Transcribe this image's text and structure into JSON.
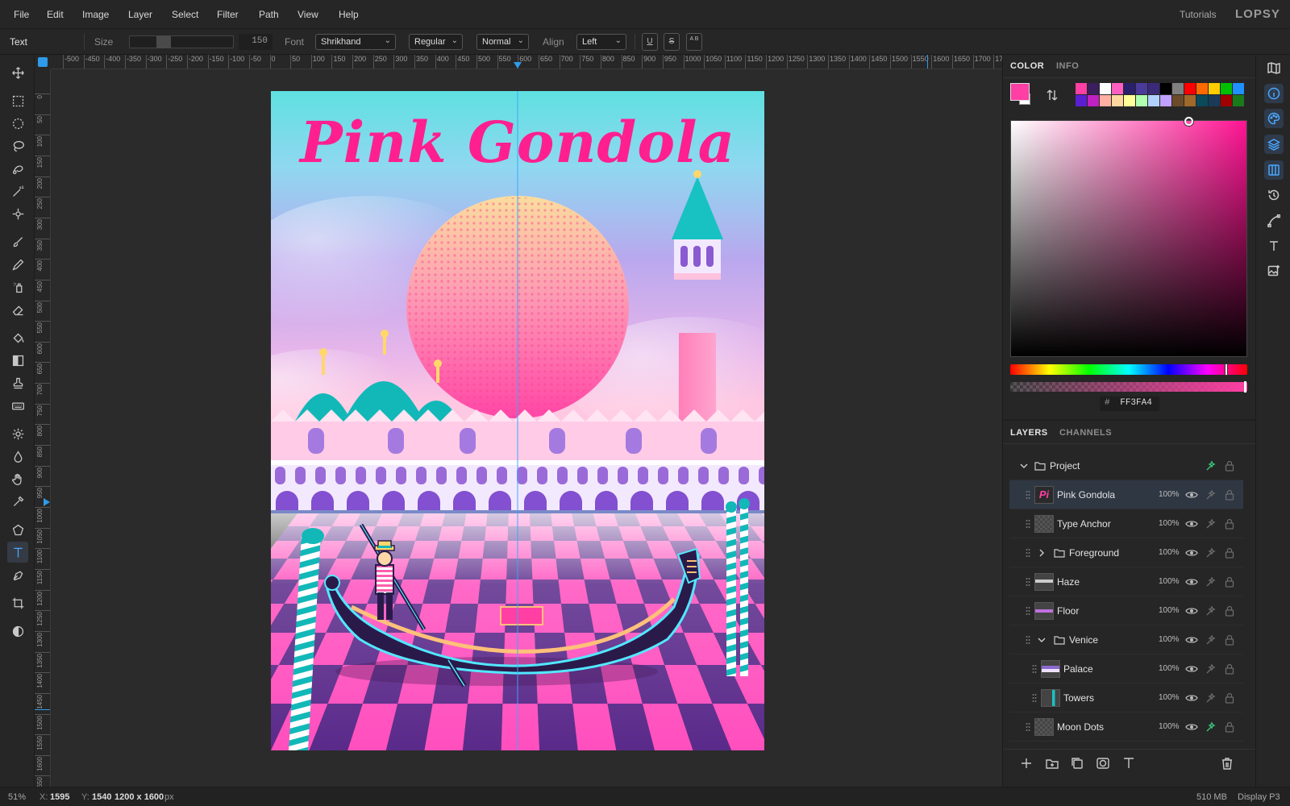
{
  "menu": [
    "File",
    "Edit",
    "Image",
    "Layer",
    "Select",
    "Filter",
    "Path",
    "View",
    "Help"
  ],
  "brand": {
    "tutorials": "Tutorials",
    "logo": "LOPSY"
  },
  "options": {
    "tool_label": "Text",
    "size_label": "Size",
    "size_value": "150",
    "font_label": "Font",
    "font_value": "Shrikhand",
    "style_value": "Regular",
    "blend_value": "Normal",
    "align_label": "Align",
    "align_value": "Left",
    "underline": "U",
    "strike": "S",
    "case": "A B"
  },
  "tools": [
    "move-icon",
    "rect-select-icon",
    "ellipse-select-icon",
    "lasso-icon",
    "quick-select-icon",
    "magic-wand-icon",
    "spot-heal-icon",
    "brush-icon",
    "pencil-icon",
    "clone-spray-icon",
    "eraser-icon",
    "fill-icon",
    "gradient-icon",
    "stamp-icon",
    "smudge-icon",
    "dodge-icon",
    "blur-icon",
    "hand-icon",
    "eyedropper-icon",
    "shape-icon",
    "text-icon",
    "pen-icon",
    "crop-icon",
    "contrast-icon"
  ],
  "active_tool": "text-icon",
  "ruler": {
    "top": [
      "-500",
      "-450",
      "-400",
      "-350",
      "-300",
      "-250",
      "-200",
      "-150",
      "-100",
      "-50",
      "0",
      "50",
      "100",
      "150",
      "200",
      "250",
      "300",
      "350",
      "400",
      "450",
      "500",
      "550",
      "600",
      "650",
      "700",
      "750",
      "800",
      "850",
      "900",
      "950",
      "1000",
      "1050",
      "1100",
      "1150",
      "1200",
      "1250",
      "1300",
      "1350",
      "1400",
      "1450",
      "1500",
      "1550",
      "1600",
      "1650",
      "1700",
      "17"
    ],
    "left": [
      "0",
      "50",
      "100",
      "150",
      "200",
      "250",
      "300",
      "350",
      "400",
      "450",
      "500",
      "550",
      "600",
      "650",
      "700",
      "750",
      "800",
      "850",
      "900",
      "950",
      "1000",
      "1050",
      "1100",
      "1150",
      "1200",
      "1250",
      "1300",
      "1350",
      "1400",
      "1450",
      "1500",
      "1550",
      "1600",
      "1650"
    ]
  },
  "poster": {
    "title": "Pink Gondola"
  },
  "color_panel": {
    "tabs": [
      "COLOR",
      "INFO"
    ],
    "foreground": "#FF3FA4",
    "hex_prefix": "#",
    "hex_value": "FF3FA4",
    "swatches_row1": [
      "#ff3fa4",
      "#3a1f5c",
      "#ffffff",
      "#ff5fc0",
      "#2a1f6b",
      "#4a3a9a",
      "#3b2a7a",
      "#000000",
      "#808080",
      "#ff0000",
      "#ff6a00",
      "#ffcc00",
      "#00c000",
      "#1e90ff"
    ],
    "swatches_row2": [
      "#5a1fd0",
      "#c020c0",
      "#ffb0a0",
      "#ffd8a0",
      "#ffff99",
      "#b0ffb0",
      "#b0d0ff",
      "#c0a0ff",
      "#6b4a2a",
      "#a0682a",
      "#0a4a5a",
      "#1a3a5a",
      "#a00000",
      "#1a7a1a"
    ]
  },
  "layers_panel": {
    "tabs": [
      "LAYERS",
      "CHANNELS"
    ],
    "layers": [
      {
        "name": "Project",
        "type": "group-root",
        "opacity": ""
      },
      {
        "name": "Pink Gondola",
        "type": "text",
        "opacity": "100%"
      },
      {
        "name": "Type Anchor",
        "type": "layer",
        "opacity": "100%"
      },
      {
        "name": "Foreground",
        "type": "group-collapsed",
        "opacity": "100%"
      },
      {
        "name": "Haze",
        "type": "layer",
        "opacity": "100%"
      },
      {
        "name": "Floor",
        "type": "layer",
        "opacity": "100%"
      },
      {
        "name": "Venice",
        "type": "group-open",
        "opacity": "100%"
      },
      {
        "name": "Palace",
        "type": "child",
        "opacity": "100%"
      },
      {
        "name": "Towers",
        "type": "child",
        "opacity": "100%"
      },
      {
        "name": "Moon Dots",
        "type": "layer",
        "opacity": "100%"
      }
    ]
  },
  "status": {
    "zoom": "51%",
    "x_label": "X:",
    "x_value": "1595",
    "y_label": "Y:",
    "y_value": "1540",
    "doc_size": "1200 x 1600",
    "doc_unit": "px",
    "memory": "510 MB",
    "profile": "Display P3"
  }
}
